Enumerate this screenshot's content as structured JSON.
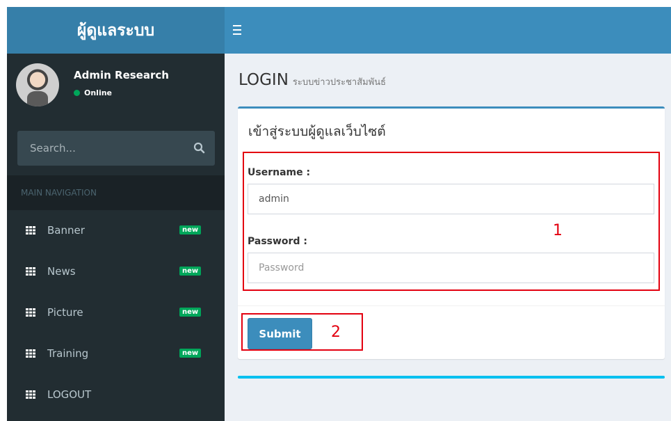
{
  "header": {
    "logo": "ผู้ดูแลระบบ"
  },
  "user": {
    "name": "Admin Research",
    "status": "Online"
  },
  "sidebar": {
    "search_placeholder": "Search...",
    "nav_header": "MAIN NAVIGATION",
    "items": [
      {
        "label": "Banner",
        "badge": "new"
      },
      {
        "label": "News",
        "badge": "new"
      },
      {
        "label": "Picture",
        "badge": "new"
      },
      {
        "label": "Training",
        "badge": "new"
      },
      {
        "label": "LOGOUT"
      }
    ]
  },
  "content": {
    "title": "LOGIN",
    "subtitle": "ระบบข่าวประชาสัมพันธ์",
    "box_title": "เข้าสู่ระบบผู้ดูแลเว็บไซต์",
    "username_label": "Username :",
    "username_value": "admin",
    "password_label": "Password :",
    "password_placeholder": "Password",
    "submit_label": "Submit"
  },
  "annotations": {
    "one": "1",
    "two": "2"
  },
  "colors": {
    "primary": "#3c8dbc",
    "logo_bg": "#367fa9",
    "sidebar_bg": "#222d32",
    "badge_green": "#00a65a",
    "annotation_red": "#e3000f",
    "accent_cyan": "#00c0ef"
  }
}
